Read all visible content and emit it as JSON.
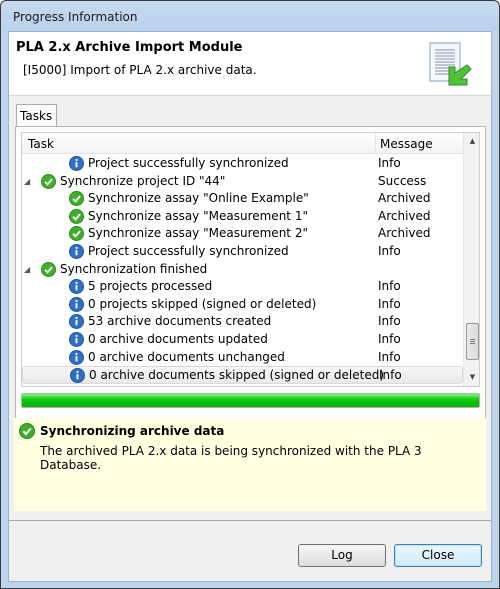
{
  "window": {
    "title": "Progress Information"
  },
  "header": {
    "title": "PLA 2.x Archive Import Module",
    "description": "[I5000] Import of PLA 2.x archive data.",
    "icon": "document-import-icon"
  },
  "tabs": [
    {
      "label": "Tasks",
      "active": true
    }
  ],
  "table": {
    "columns": [
      {
        "label": "Task"
      },
      {
        "label": "Message"
      }
    ],
    "rows": [
      {
        "level": 1,
        "expander": false,
        "icon": "info-icon",
        "text": "Project successfully synchronized",
        "message": "Info"
      },
      {
        "level": 0,
        "expander": true,
        "icon": "check-icon",
        "text": "Synchronize project ID \"44\"",
        "message": "Success"
      },
      {
        "level": 1,
        "expander": false,
        "icon": "check-icon",
        "text": "Synchronize assay \"Online Example\"",
        "message": "Archived"
      },
      {
        "level": 1,
        "expander": false,
        "icon": "check-icon",
        "text": "Synchronize assay \"Measurement 1\"",
        "message": "Archived"
      },
      {
        "level": 1,
        "expander": false,
        "icon": "check-icon",
        "text": "Synchronize assay \"Measurement 2\"",
        "message": "Archived"
      },
      {
        "level": 1,
        "expander": false,
        "icon": "info-icon",
        "text": "Project successfully synchronized",
        "message": "Info"
      },
      {
        "level": 0,
        "expander": true,
        "icon": "check-icon",
        "text": "Synchronization finished",
        "message": ""
      },
      {
        "level": 1,
        "expander": false,
        "icon": "info-icon",
        "text": "5 projects processed",
        "message": "Info"
      },
      {
        "level": 1,
        "expander": false,
        "icon": "info-icon",
        "text": "0 projects skipped (signed or deleted)",
        "message": "Info"
      },
      {
        "level": 1,
        "expander": false,
        "icon": "info-icon",
        "text": "53 archive documents created",
        "message": "Info"
      },
      {
        "level": 1,
        "expander": false,
        "icon": "info-icon",
        "text": "0 archive documents updated",
        "message": "Info"
      },
      {
        "level": 1,
        "expander": false,
        "icon": "info-icon",
        "text": "0 archive documents unchanged",
        "message": "Info"
      },
      {
        "level": 1,
        "expander": false,
        "icon": "info-icon",
        "text": "0 archive documents skipped (signed or deleted)",
        "message": "Info",
        "selected": true
      }
    ]
  },
  "progress": {
    "percent": 100,
    "color": "#05c105"
  },
  "status": {
    "title": "Synchronizing archive data",
    "description": "The archived PLA 2.x data is being synchronized with the PLA 3 Database.",
    "icon": "check-icon"
  },
  "buttons": {
    "log_label": "Log",
    "close_label": "Close"
  },
  "colors": {
    "info": "#2f6fc4",
    "success": "#3fae2a",
    "status_bg": "#ffffe1"
  }
}
